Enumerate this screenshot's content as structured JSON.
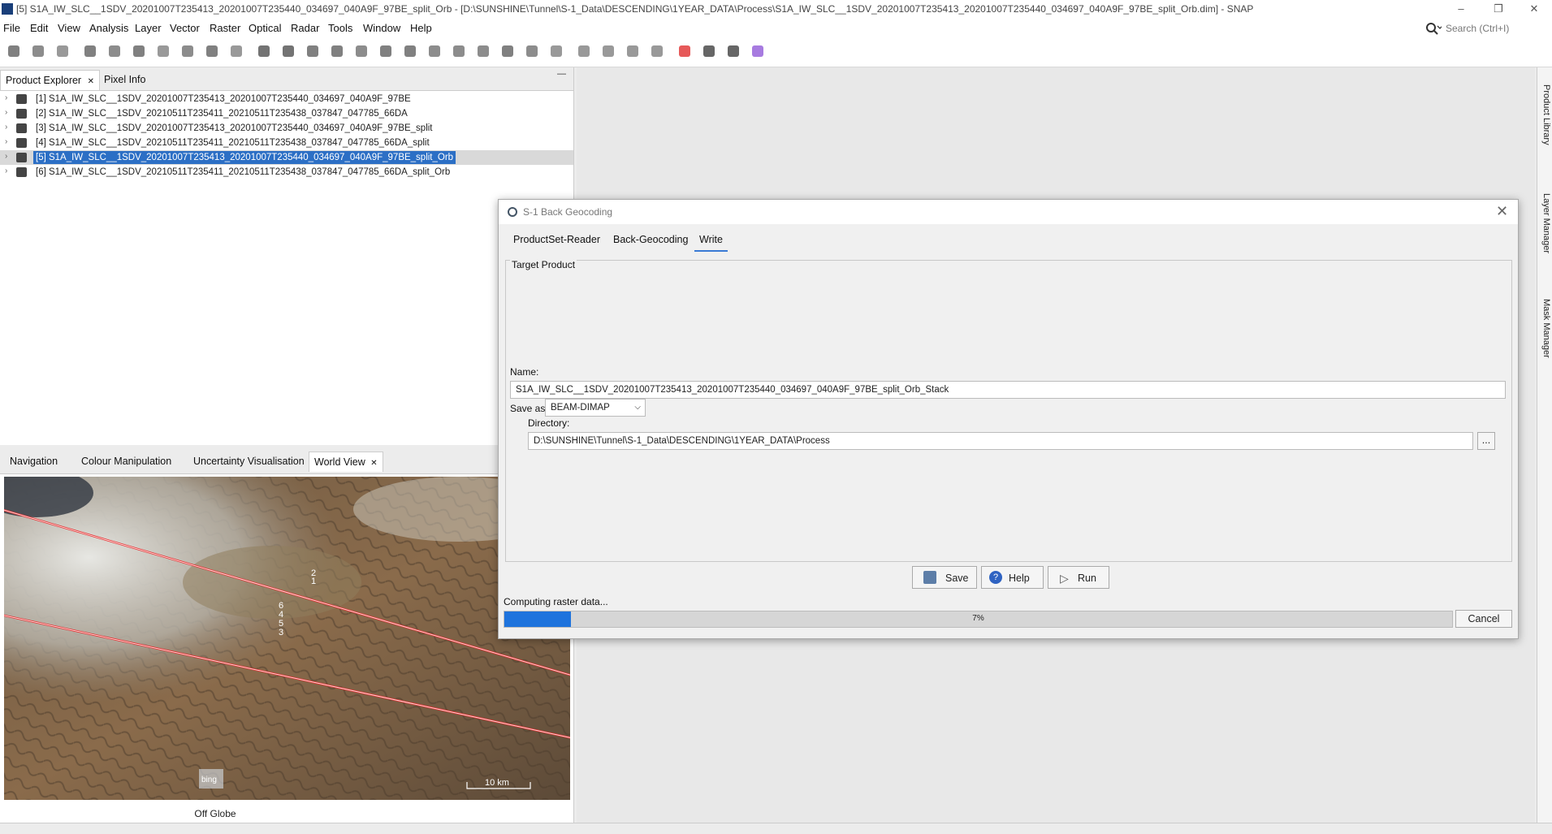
{
  "window": {
    "title": "[5] S1A_IW_SLC__1SDV_20201007T235413_20201007T235440_034697_040A9F_97BE_split_Orb - [D:\\SUNSHINE\\Tunnel\\S-1_Data\\DESCENDING\\1YEAR_DATA\\Process\\S1A_IW_SLC__1SDV_20201007T235413_20201007T235440_034697_040A9F_97BE_split_Orb.dim] - SNAP",
    "minimize": "–",
    "restore": "❐",
    "close": "✕"
  },
  "menu": [
    "File",
    "Edit",
    "View",
    "Analysis",
    "Layer",
    "Vector",
    "Raster",
    "Optical",
    "Radar",
    "Tools",
    "Window",
    "Help"
  ],
  "search": {
    "placeholder": "Search (Ctrl+I)"
  },
  "toolbar_icons": [
    "open-product-icon",
    "save-product-icon",
    "gcp-tool-icon",
    "graph-builder-icon",
    "grid-icon",
    "pin-icon",
    "gcp-label-icon",
    "spectrum-icon",
    "mask-icon",
    "range-icon",
    "select-tool-icon",
    "pan-tool-icon",
    "zoom-tool-icon",
    "zoom-plus-icon",
    "gcp-placing-icon",
    "line-draw-icon",
    "polyline-draw-icon",
    "rectangle-draw-icon",
    "polygon-draw-icon",
    "ellipse-draw-icon",
    "magic-wand-icon",
    "range-finder-icon",
    "ruler-icon",
    "tile-horizontal-icon",
    "tile-vertical-icon",
    "tile-grid-icon",
    "tile-tabbed-icon",
    "star-icon",
    "cross-icon",
    "binary-icon",
    "layers-icon"
  ],
  "left_tabs": {
    "product_explorer": "Product Explorer",
    "pixel_info": "Pixel Info",
    "close": "✕",
    "minimize": "—"
  },
  "products": [
    "[1] S1A_IW_SLC__1SDV_20201007T235413_20201007T235440_034697_040A9F_97BE",
    "[2] S1A_IW_SLC__1SDV_20210511T235411_20210511T235438_037847_047785_66DA",
    "[3] S1A_IW_SLC__1SDV_20201007T235413_20201007T235440_034697_040A9F_97BE_split",
    "[4] S1A_IW_SLC__1SDV_20210511T235411_20210511T235438_037847_047785_66DA_split",
    "[5] S1A_IW_SLC__1SDV_20201007T235413_20201007T235440_034697_040A9F_97BE_split_Orb",
    "[6] S1A_IW_SLC__1SDV_20210511T235411_20210511T235438_037847_047785_66DA_split_Orb"
  ],
  "selected_product_index": 4,
  "bottom_tabs": {
    "navigation": "Navigation",
    "colour": "Colour Manipulation",
    "uncertainty": "Uncertainty Visualisation",
    "world": "World View",
    "close": "✕"
  },
  "map": {
    "labels": [
      "2",
      "1",
      "6",
      "4",
      "5",
      "3"
    ],
    "scale": "10 km",
    "bing": "bing",
    "status": "Off Globe"
  },
  "side_tabs": [
    "Product Library",
    "Layer Manager",
    "Mask Manager"
  ],
  "dialog": {
    "title": "S-1 Back Geocoding",
    "close": "✕",
    "tabs": [
      "ProductSet-Reader",
      "Back-Geocoding",
      "Write"
    ],
    "active_tab": "Write",
    "target_product": "Target Product",
    "name_label": "Name:",
    "name_value": "S1A_IW_SLC__1SDV_20201007T235413_20201007T235440_034697_040A9F_97BE_split_Orb_Stack",
    "save_as_label": "Save as:",
    "save_as_value": "BEAM-DIMAP",
    "directory_label": "Directory:",
    "directory_value": "D:\\SUNSHINE\\Tunnel\\S-1_Data\\DESCENDING\\1YEAR_DATA\\Process",
    "browse": "...",
    "buttons": {
      "save": "Save",
      "help": "Help",
      "run": "Run",
      "cancel": "Cancel"
    },
    "progress_label": "Computing raster data...",
    "progress_text": "7%",
    "progress_fraction": 0.07
  },
  "colors": {
    "selection": "#2c6fc5",
    "progress": "#1e73dd",
    "footprint": "#e53030"
  }
}
